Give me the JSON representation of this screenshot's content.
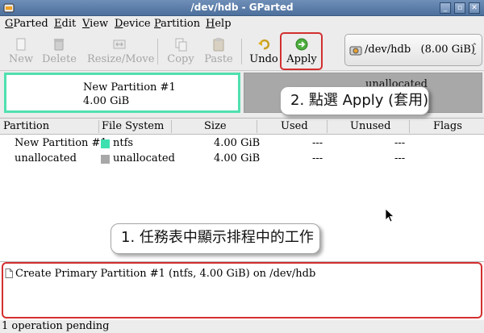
{
  "window": {
    "title": "/dev/hdb - GParted",
    "controls": {
      "minimize": "_",
      "maximize": "▫",
      "close": "✕"
    }
  },
  "menu": [
    {
      "label": "GParted",
      "mnemonic": "G",
      "rest": "Parted"
    },
    {
      "label": "Edit",
      "mnemonic": "E",
      "rest": "dit"
    },
    {
      "label": "View",
      "mnemonic": "V",
      "rest": "iew"
    },
    {
      "label": "Device",
      "mnemonic": "D",
      "rest": "evice"
    },
    {
      "label": "Partition",
      "mnemonic": "P",
      "rest": "artition"
    },
    {
      "label": "Help",
      "mnemonic": "H",
      "rest": "elp"
    }
  ],
  "toolbar": {
    "new": "New",
    "delete": "Delete",
    "resize_move": "Resize/Move",
    "copy": "Copy",
    "paste": "Paste",
    "undo": "Undo",
    "apply": "Apply",
    "device_path": "/dev/hdb",
    "device_size": "(8.00 GiB)"
  },
  "diskmap": {
    "new_partition": {
      "name": "New Partition #1",
      "size": "4.00 GiB",
      "color": "#50e0b0"
    },
    "unallocated": {
      "name": "unallocated",
      "color": "#a8a8a8"
    }
  },
  "callouts": {
    "apply_tip": "2. 點選 Apply (套用)",
    "queue_tip": "1. 任務表中顯示排程中的工作"
  },
  "table": {
    "headers": {
      "partition": "Partition",
      "filesystem": "File System",
      "size": "Size",
      "used": "Used",
      "unused": "Unused",
      "flags": "Flags"
    },
    "rows": [
      {
        "partition": "New Partition #1",
        "filesystem": "ntfs",
        "fs_color": "#3ee0b0",
        "size": "4.00 GiB",
        "used": "---",
        "unused": "---",
        "flags": ""
      },
      {
        "partition": "unallocated",
        "filesystem": "unallocated",
        "fs_color": "#a8a8a8",
        "size": "4.00 GiB",
        "used": "---",
        "unused": "---",
        "flags": ""
      }
    ]
  },
  "operations": [
    {
      "text": "Create Primary Partition #1 (ntfs, 4.00 GiB) on /dev/hdb"
    }
  ],
  "status": {
    "text": "1 operation pending"
  },
  "colors": {
    "highlight": "#d32f2f",
    "titlebar": "#5a7aa8"
  }
}
